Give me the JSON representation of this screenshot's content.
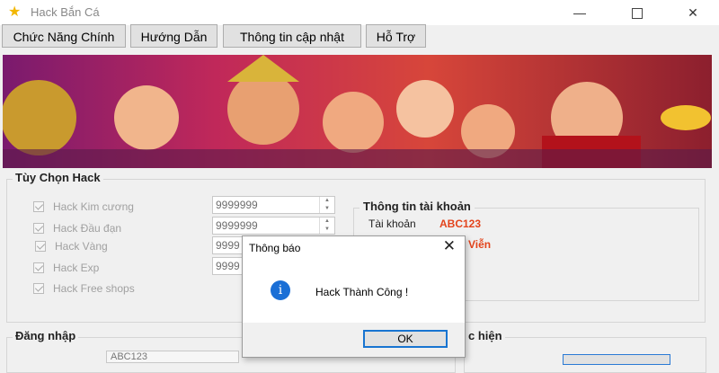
{
  "window": {
    "title": "Hack Bắn Cá"
  },
  "menu": [
    {
      "label": "Chức Năng Chính"
    },
    {
      "label": "Hướng Dẫn"
    },
    {
      "label": "Thông tin cập nhật"
    },
    {
      "label": "Hỗ Trợ"
    }
  ],
  "hack_options": {
    "title": "Tùy Chọn Hack",
    "items": [
      {
        "label": "Hack Kim cương",
        "value": "9999999",
        "checked": true
      },
      {
        "label": "Hack Đầu đạn",
        "value": "9999999",
        "checked": true
      },
      {
        "label": "Hack Vàng",
        "value": "9999",
        "checked": true
      },
      {
        "label": "Hack Exp",
        "value": "9999",
        "checked": true
      },
      {
        "label": "Hack Free shops",
        "checked": true
      }
    ]
  },
  "account_info": {
    "title": "Thông tin tài khoản",
    "account_label": "Tài khoản",
    "account_value": "ABC123",
    "status_value": "Viễn"
  },
  "login": {
    "title": "Đăng nhập",
    "field_value": "ABC123"
  },
  "partial_group_title": "c hiện",
  "dialog": {
    "title": "Thông báo",
    "message": "Hack Thành Công !",
    "ok_label": "OK",
    "icon_glyph": "i"
  },
  "colors": {
    "accent": "#e3441c",
    "dialog_icon": "#1a6fd6"
  }
}
